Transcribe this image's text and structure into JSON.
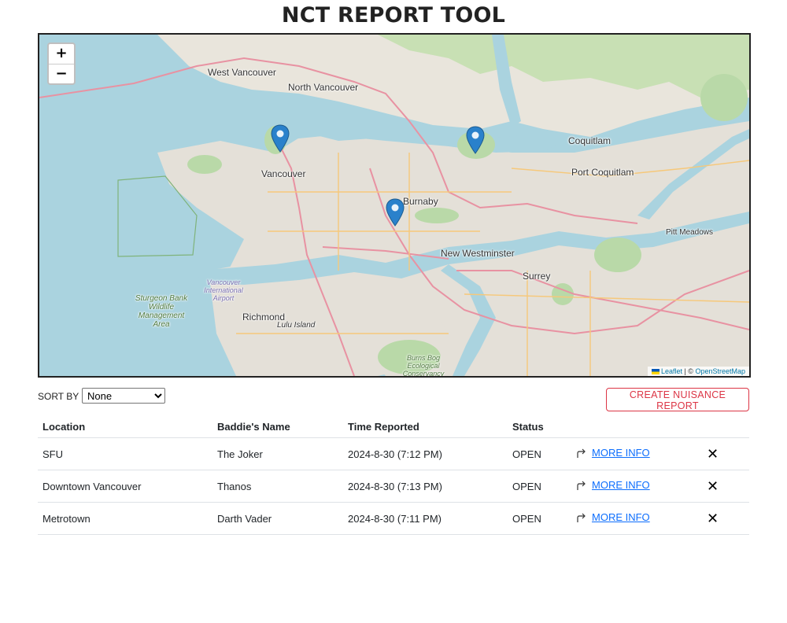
{
  "page": {
    "title": "NCT REPORT TOOL"
  },
  "map": {
    "zoom_in": "+",
    "zoom_out": "−",
    "labels": {
      "west_vancouver": "West Vancouver",
      "north_vancouver": "North Vancouver",
      "vancouver": "Vancouver",
      "burnaby": "Burnaby",
      "coquitlam": "Coquitlam",
      "port_coquitlam": "Port Coquitlam",
      "pitt_meadows": "Pitt Meadows",
      "new_westminster": "New Westminster",
      "surrey": "Surrey",
      "richmond": "Richmond",
      "lulu_island": "Lulu Island",
      "sturgeon_bank": "Sturgeon Bank Wildlife Management Area",
      "airport": "Vancouver International Airport",
      "burns_bog": "Burns Bog Ecological Conservancy"
    },
    "attribution": {
      "leaflet": "Leaflet",
      "separator": " | © ",
      "osm": "OpenStreetMap"
    },
    "marker_color": "#2a81cb"
  },
  "controls": {
    "sort_label": "SORT BY",
    "sort_value": "None",
    "create_button": "CREATE NUISANCE REPORT"
  },
  "table": {
    "headers": {
      "location": "Location",
      "baddie": "Baddie's Name",
      "time": "Time Reported",
      "status": "Status"
    },
    "rows": [
      {
        "location": "SFU",
        "baddie": "The Joker",
        "time": "2024-8-30 (7:12 PM)",
        "status": "OPEN",
        "more": "MORE INFO"
      },
      {
        "location": "Downtown Vancouver",
        "baddie": "Thanos",
        "time": "2024-8-30 (7:13 PM)",
        "status": "OPEN",
        "more": "MORE INFO"
      },
      {
        "location": "Metrotown",
        "baddie": "Darth Vader",
        "time": "2024-8-30 (7:11 PM)",
        "status": "OPEN",
        "more": "MORE INFO"
      }
    ]
  },
  "colors": {
    "accent_red": "#dc3545",
    "link_blue": "#0d6efd",
    "water": "#aad3df",
    "land": "#e8e4dc",
    "park": "#b9d9a8"
  }
}
